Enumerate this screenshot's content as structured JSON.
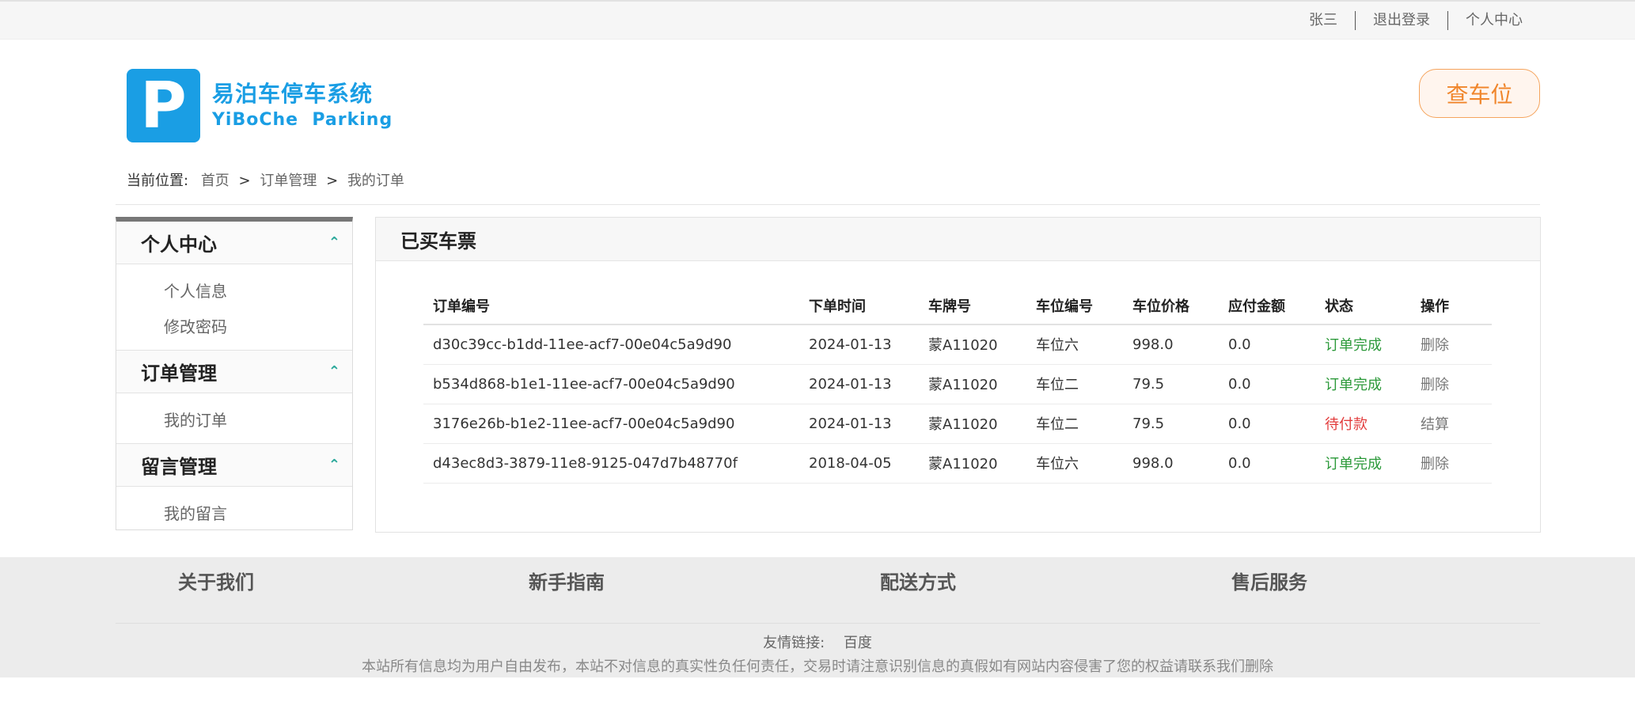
{
  "topbar": {
    "user": "张三",
    "logout": "退出登录",
    "personal_center": "个人中心"
  },
  "logo": {
    "letter": "P",
    "name_cn": "易泊车停车系统",
    "name_en": "YiBoChe  Parking"
  },
  "search_button": "查车位",
  "breadcrumb": {
    "label": "当前位置:",
    "home": "首页",
    "section": "订单管理",
    "current": "我的订单",
    "separator": ">"
  },
  "sidebar": {
    "groups": [
      {
        "title": "个人中心",
        "items": [
          "个人信息",
          "修改密码"
        ]
      },
      {
        "title": "订单管理",
        "items": [
          "我的订单"
        ]
      },
      {
        "title": "留言管理",
        "items": [
          "我的留言"
        ]
      }
    ]
  },
  "panel": {
    "title": "已买车票",
    "columns": [
      "订单编号",
      "下单时间",
      "车牌号",
      "车位编号",
      "车位价格",
      "应付金额",
      "状态",
      "操作"
    ],
    "rows": [
      {
        "order_id": "d30c39cc-b1dd-11ee-acf7-00e04c5a9d90",
        "date": "2024-01-13",
        "plate": "蒙A11020",
        "spot": "车位六",
        "price": "998.0",
        "due": "0.0",
        "status": "订单完成",
        "status_color": "#2d9a3b",
        "action": "删除"
      },
      {
        "order_id": "b534d868-b1e1-11ee-acf7-00e04c5a9d90",
        "date": "2024-01-13",
        "plate": "蒙A11020",
        "spot": "车位二",
        "price": "79.5",
        "due": "0.0",
        "status": "订单完成",
        "status_color": "#2d9a3b",
        "action": "删除"
      },
      {
        "order_id": "3176e26b-b1e2-11ee-acf7-00e04c5a9d90",
        "date": "2024-01-13",
        "plate": "蒙A11020",
        "spot": "车位二",
        "price": "79.5",
        "due": "0.0",
        "status": "待付款",
        "status_color": "#e23b3b",
        "action": "结算"
      },
      {
        "order_id": "d43ec8d3-3879-11e8-9125-047d7b48770f",
        "date": "2018-04-05",
        "plate": "蒙A11020",
        "spot": "车位六",
        "price": "998.0",
        "due": "0.0",
        "status": "订单完成",
        "status_color": "#2d9a3b",
        "action": "删除"
      }
    ]
  },
  "footer": {
    "columns": [
      "关于我们",
      "新手指南",
      "配送方式",
      "售后服务"
    ],
    "friend_label": "友情链接:",
    "friend_link": "百度",
    "notice": "本站所有信息均为用户自由发布，本站不对信息的真实性负任何责任，交易时请注意识别信息的真假如有网站内容侵害了您的权益请联系我们删除"
  },
  "colors": {
    "brand": "#1a9ee4",
    "accent_orange": "#f0862c",
    "chevron": "#2aa89a"
  }
}
